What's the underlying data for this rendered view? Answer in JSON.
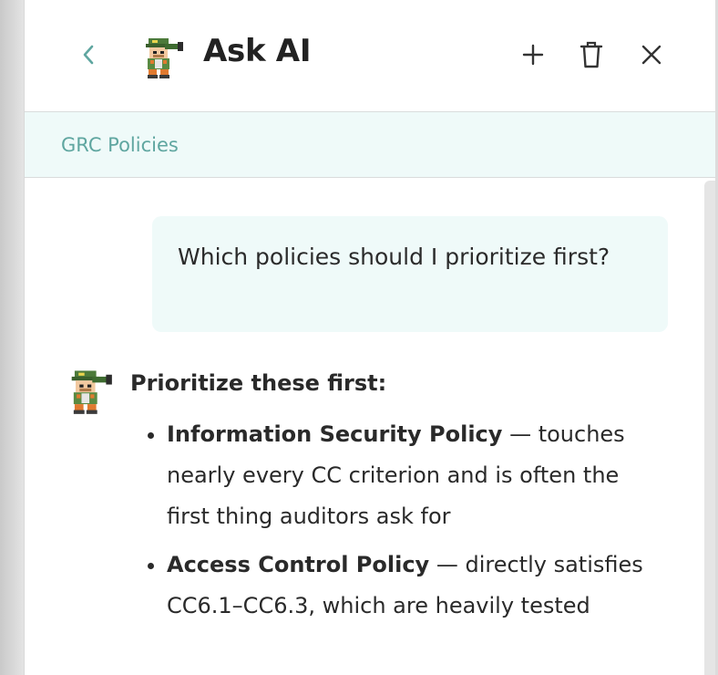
{
  "header": {
    "title": "Ask AI"
  },
  "breadcrumb": {
    "label": "GRC Policies"
  },
  "conversation": {
    "user_message": "Which policies should I prioritize first?",
    "ai_heading": "Prioritize these first:",
    "items": [
      {
        "title": "Information Security Policy",
        "text": " — touches nearly every CC criterion and is often the first thing auditors ask for"
      },
      {
        "title": "Access Control Policy",
        "text": " — directly satisfies CC6.1–CC6.3, which are heavily tested"
      }
    ]
  },
  "colors": {
    "accent": "#5fa6a0",
    "bubble_bg": "#effaf9",
    "text": "#2a2a2a"
  },
  "icons": [
    "chevron-left-icon",
    "robot-avatar-icon",
    "plus-icon",
    "trash-icon",
    "close-icon"
  ]
}
